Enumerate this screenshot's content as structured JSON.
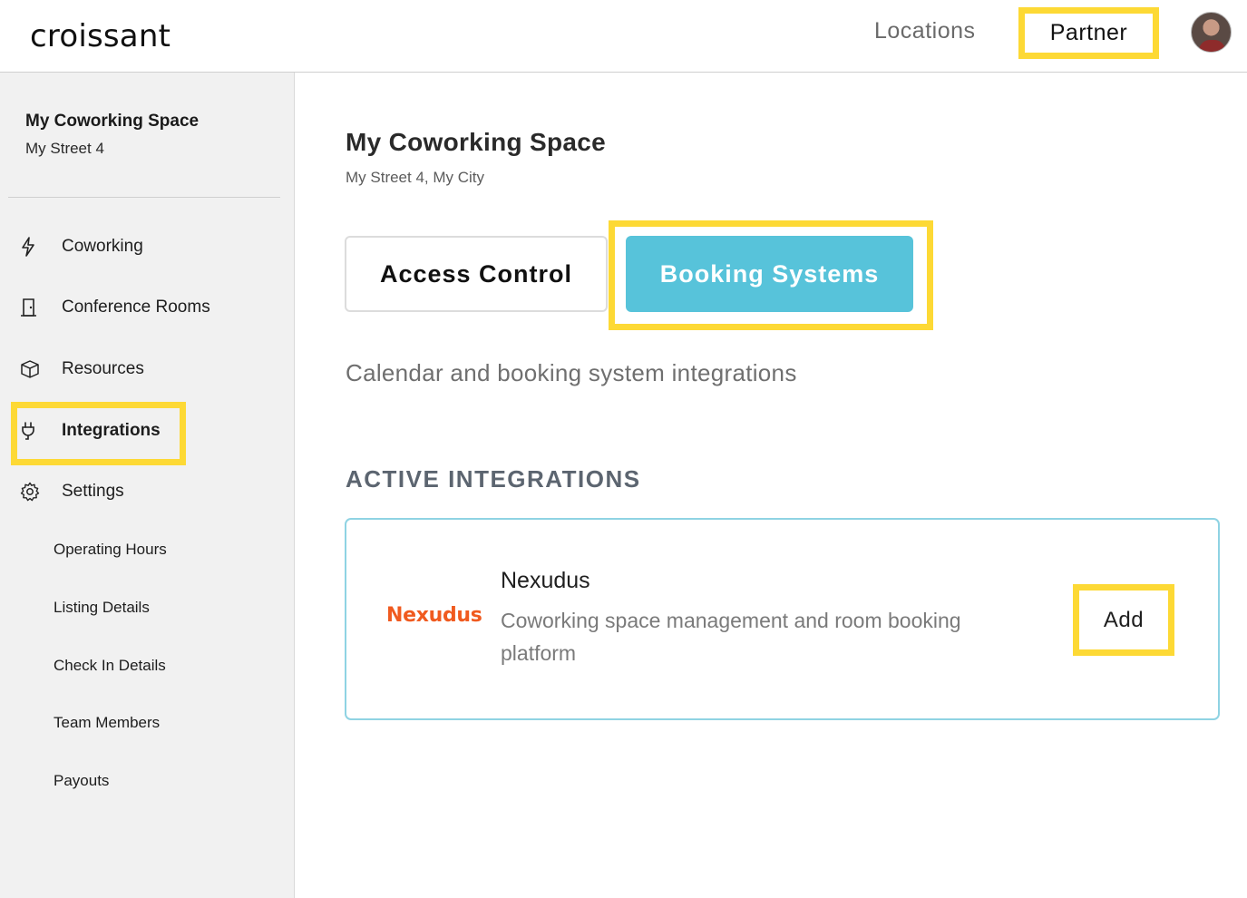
{
  "header": {
    "logo": "croissant",
    "nav_locations": "Locations",
    "nav_partner": "Partner"
  },
  "sidebar": {
    "workspace_name": "My Coworking Space",
    "workspace_street": "My Street 4",
    "items": [
      {
        "label": "Coworking",
        "icon": "lightning-icon"
      },
      {
        "label": "Conference Rooms",
        "icon": "door-icon"
      },
      {
        "label": "Resources",
        "icon": "box-icon"
      },
      {
        "label": "Integrations",
        "icon": "plug-icon",
        "active": true
      },
      {
        "label": "Settings",
        "icon": "gear-icon"
      }
    ],
    "settings_sub": [
      "Operating Hours",
      "Listing Details",
      "Check In Details",
      "Team Members",
      "Payouts"
    ]
  },
  "main": {
    "title": "My Coworking Space",
    "address": "My Street 4, My City",
    "tabs": [
      {
        "label": "Access Control",
        "selected": false
      },
      {
        "label": "Booking Systems",
        "selected": true
      }
    ],
    "description": "Calendar and booking system integrations",
    "section_heading": "ACTIVE INTEGRATIONS",
    "integration": {
      "logo_text": "Nexudus",
      "name": "Nexudus",
      "description": "Coworking space management and room booking platform",
      "action": "Add"
    }
  },
  "colors": {
    "accent_highlight": "#fdd935",
    "tab_selected": "#57c3da",
    "nexudus_brand": "#f05a1f",
    "card_border": "#8fd3e3"
  }
}
